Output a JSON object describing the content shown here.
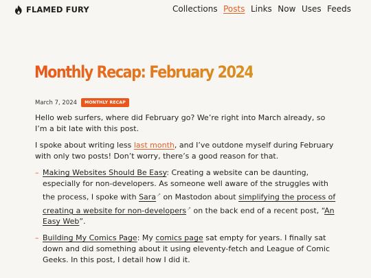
{
  "site": {
    "name": "FLAMED FURY",
    "logo_icon": "flame-icon"
  },
  "nav": [
    {
      "label": "Collections",
      "active": false
    },
    {
      "label": "Posts",
      "active": true
    },
    {
      "label": "Links",
      "active": false
    },
    {
      "label": "Now",
      "active": false
    },
    {
      "label": "Uses",
      "active": false
    },
    {
      "label": "Feeds",
      "active": false
    }
  ],
  "post": {
    "title": "Monthly Recap: February 2024",
    "date": "March 7, 2024",
    "tag": "MONTHLY RECAP",
    "p1": "Hello web surfers, where did February go? We’re right into March already, so I’m a bit late with this post.",
    "p2_a": "I spoke about writing less ",
    "p2_link": "last month",
    "p2_b": ", and I’ve outdone myself during February with only two posts! Don’t worry, there’s a good reason for that.",
    "item1_title": "Making Websites Should Be Easy",
    "item1_a": ": Creating a website can be daunting, especially for non-developers. As someone well aware of the struggles with the process, I spoke with ",
    "item1_link_sara": "Sara",
    "item1_b": " on Mastodon about ",
    "item1_link_simplify": "simplifying the process of creating a website for non-developers",
    "item1_c": " on the back end of a recent post, “",
    "item1_link_easyweb": "An Easy Web",
    "item1_d": "”.",
    "item2_title": "Building My Comics Page",
    "item2_a": ": My ",
    "item2_link": "comics page",
    "item2_b": " sat empty for years. I finally sat down and did something about it using eleventy-fetch and League of Comic Geeks. In this post, I detail how I did it."
  },
  "colors": {
    "accent": "#e8571c",
    "background": "#f7f6f3",
    "text": "#222222"
  }
}
